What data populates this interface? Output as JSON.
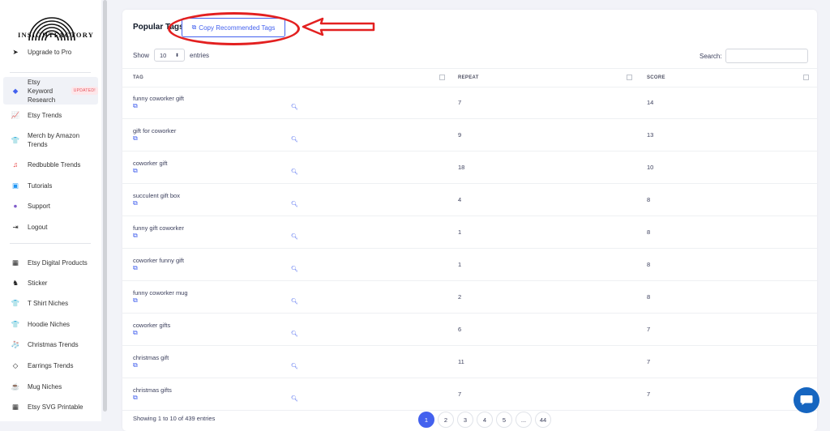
{
  "brand": {
    "name": "INSIGHTFACTORY"
  },
  "sidebar": {
    "items": [
      {
        "label": "Upgrade to Pro",
        "icon": "paper-plane-icon",
        "glyph": "➤",
        "color": "#222222"
      },
      {
        "label": "Etsy Keyword Research",
        "icon": "tag-icon",
        "glyph": "◆",
        "color": "#4361ee",
        "badge": "UPDATED!",
        "active": true
      },
      {
        "label": "Etsy Trends",
        "icon": "chart-icon",
        "glyph": "📈",
        "color": "#222222"
      },
      {
        "label": "Merch by Amazon Trends",
        "icon": "shirt-icon",
        "glyph": "👕",
        "color": "#222222"
      },
      {
        "label": "Redbubble Trends",
        "icon": "music-icon",
        "glyph": "♫",
        "color": "#e32020"
      },
      {
        "label": "Tutorials",
        "icon": "tv-icon",
        "glyph": "▣",
        "color": "#2196f3"
      },
      {
        "label": "Support",
        "icon": "chat-bubble-icon",
        "glyph": "●",
        "color": "#805dca"
      },
      {
        "label": "Logout",
        "icon": "logout-icon",
        "glyph": "⇥",
        "color": "#222222"
      }
    ],
    "items2": [
      {
        "label": "Etsy Digital Products",
        "icon": "qr-icon",
        "glyph": "▦",
        "color": "#222222"
      },
      {
        "label": "Sticker",
        "icon": "horse-icon",
        "glyph": "♞",
        "color": "#222222"
      },
      {
        "label": "T Shirt Niches",
        "icon": "tshirt-icon",
        "glyph": "👕",
        "color": "#222222"
      },
      {
        "label": "Hoodie Niches",
        "icon": "hoodie-icon",
        "glyph": "👕",
        "color": "#222222"
      },
      {
        "label": "Christmas Trends",
        "icon": "stocking-icon",
        "glyph": "🧦",
        "color": "#222222"
      },
      {
        "label": "Earrings Trends",
        "icon": "gem-icon",
        "glyph": "◇",
        "color": "#222222"
      },
      {
        "label": "Mug Niches",
        "icon": "mug-icon",
        "glyph": "☕",
        "color": "#222222"
      },
      {
        "label": "Etsy SVG Printable",
        "icon": "qr-icon",
        "glyph": "▦",
        "color": "#222222"
      }
    ]
  },
  "main": {
    "title": "Popular Tags",
    "copy_button": "Copy Recommended Tags",
    "show_label": "Show",
    "entries_label": "entries",
    "show_value": "10",
    "search_label": "Search:",
    "columns": [
      "TAG",
      "REPEAT",
      "SCORE"
    ],
    "rows": [
      {
        "tag": "funny coworker gift",
        "repeat": "7",
        "score": "14"
      },
      {
        "tag": "gift for coworker",
        "repeat": "9",
        "score": "13"
      },
      {
        "tag": "coworker gift",
        "repeat": "18",
        "score": "10"
      },
      {
        "tag": "succulent gift box",
        "repeat": "4",
        "score": "8"
      },
      {
        "tag": "funny gift coworker",
        "repeat": "1",
        "score": "8"
      },
      {
        "tag": "coworker funny gift",
        "repeat": "1",
        "score": "8"
      },
      {
        "tag": "funny coworker mug",
        "repeat": "2",
        "score": "8"
      },
      {
        "tag": "coworker gifts",
        "repeat": "6",
        "score": "7"
      },
      {
        "tag": "christmas gift",
        "repeat": "11",
        "score": "7"
      },
      {
        "tag": "christmas gifts",
        "repeat": "7",
        "score": "7"
      }
    ],
    "footer": "Showing 1 to 10 of 439 entries",
    "pages": [
      "1",
      "2",
      "3",
      "4",
      "5",
      "...",
      "44"
    ],
    "active_page": "1"
  },
  "colors": {
    "accent": "#4361ee",
    "highlight": "#e32020"
  }
}
